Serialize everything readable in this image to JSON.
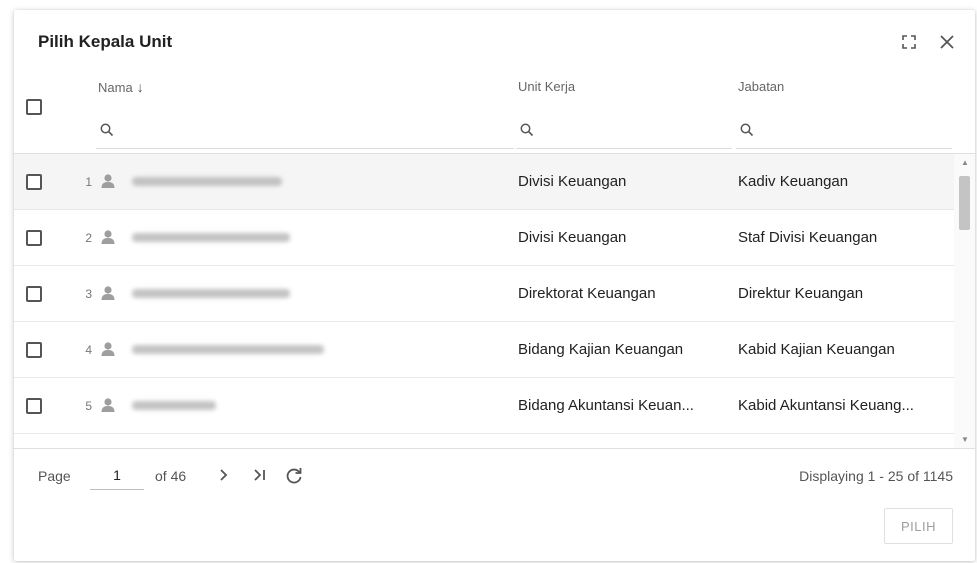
{
  "dialog": {
    "title": "Pilih Kepala Unit"
  },
  "columns": {
    "nama": {
      "label": "Nama",
      "sort_icon": "arrow-down-icon"
    },
    "unit_kerja": {
      "label": "Unit Kerja"
    },
    "jabatan": {
      "label": "Jabatan"
    }
  },
  "rows": [
    {
      "num": "1",
      "unit_kerja": "Divisi Keuangan",
      "jabatan": "Kadiv Keuangan"
    },
    {
      "num": "2",
      "unit_kerja": "Divisi Keuangan",
      "jabatan": "Staf Divisi Keuangan"
    },
    {
      "num": "3",
      "unit_kerja": "Direktorat Keuangan",
      "jabatan": "Direktur Keuangan"
    },
    {
      "num": "4",
      "unit_kerja": "Bidang Kajian Keuangan",
      "jabatan": "Kabid Kajian Keuangan"
    },
    {
      "num": "5",
      "unit_kerja": "Bidang Akuntansi Keuan...",
      "jabatan": "Kabid Akuntansi Keuang..."
    }
  ],
  "paging": {
    "page_label": "Page",
    "current_page": "1",
    "of_label": "of 46",
    "displaying": "Displaying 1 - 25 of 1145"
  },
  "actions": {
    "pilih": "PILIH"
  },
  "colors": {
    "accent": "#212121",
    "muted": "#9e9e9e",
    "selected_row": "#f5f5f5"
  }
}
